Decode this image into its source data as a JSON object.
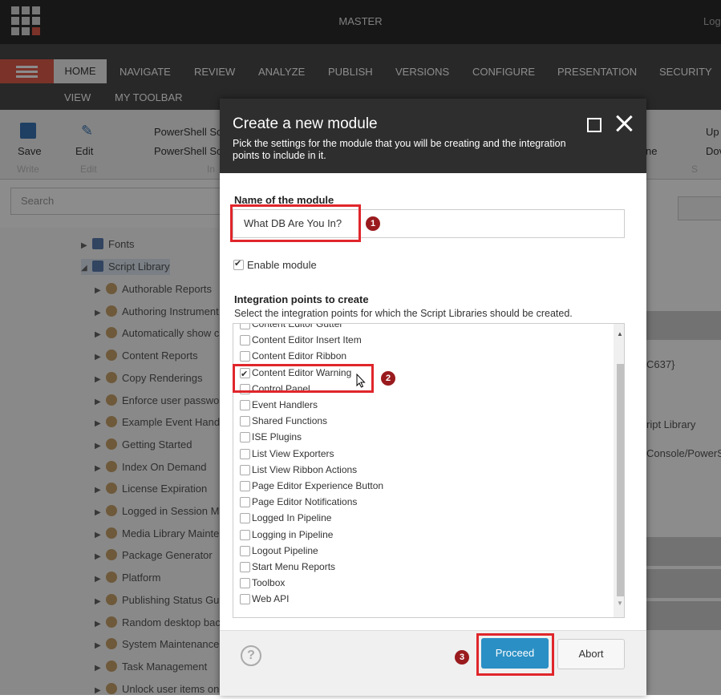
{
  "header": {
    "title": "MASTER",
    "logout": "Log"
  },
  "tabs": [
    "HOME",
    "NAVIGATE",
    "REVIEW",
    "ANALYZE",
    "PUBLISH",
    "VERSIONS",
    "CONFIGURE",
    "PRESENTATION",
    "SECURITY",
    "VIEW",
    "MY TOOLBAR"
  ],
  "ribbon": {
    "save": "Save",
    "write": "Write",
    "edit": "Edit",
    "edit_group": "Edit",
    "ps1": "PowerShell Sc",
    "ps2": "PowerShell Sc",
    "group_i": "In",
    "up": "Up",
    "down": "Dov",
    "ne": "ne",
    "s": "S"
  },
  "search": {
    "placeholder": "Search"
  },
  "tree": {
    "fonts": "Fonts",
    "script_library": "Script Library",
    "items": [
      "Authorable Reports",
      "Authoring Instrument",
      "Automatically show c",
      "Content Reports",
      "Copy Renderings",
      "Enforce user passwo",
      "Example Event Hand",
      "Getting Started",
      "Index On Demand",
      "License Expiration",
      "Logged in Session M",
      "Media Library Mainte",
      "Package Generator",
      "Platform",
      "Publishing Status Gu",
      "Random desktop bac",
      "System Maintenance",
      "Task Management",
      "Unlock user items on logout"
    ]
  },
  "right": {
    "guid": "C637}",
    "lib": "ript Library",
    "path": "Console/PowerS"
  },
  "modal": {
    "title": "Create a new module",
    "subtitle": "Pick the settings for the module that you will be creating and the integration points to include in it.",
    "name_label": "Name of the module",
    "name_value": "What DB Are You In?",
    "enable_label": "Enable module",
    "integration_label": "Integration points to create",
    "integration_desc": "Select the integration points for which the Script Libraries should be created.",
    "items": [
      "Content Editor Gutter",
      "Content Editor Insert Item",
      "Content Editor Ribbon",
      "Content Editor Warning",
      "Control Panel",
      "Event Handlers",
      "Shared Functions",
      "ISE Plugins",
      "List View Exporters",
      "List View Ribbon Actions",
      "Page Editor Experience Button",
      "Page Editor Notifications",
      "Logged In Pipeline",
      "Logging in Pipeline",
      "Logout Pipeline",
      "Start Menu Reports",
      "Toolbox",
      "Web API"
    ],
    "proceed": "Proceed",
    "abort": "Abort",
    "help": "?"
  },
  "annotations": [
    "1",
    "2",
    "3"
  ],
  "colors": {
    "accent": "#2a8fc4",
    "annotation": "#e0262b",
    "hamburger": "#e05c4b"
  }
}
